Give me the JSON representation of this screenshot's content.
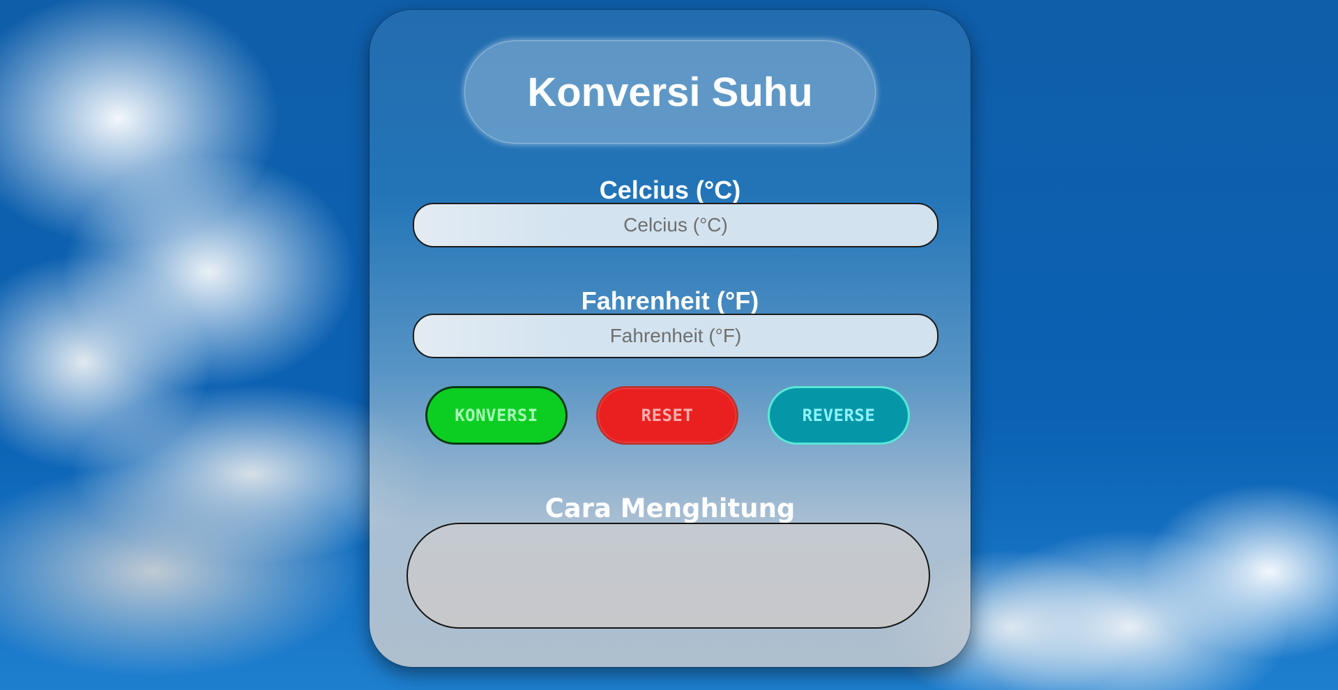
{
  "app": {
    "title": "Konversi Suhu"
  },
  "celcius": {
    "label": "Celcius (°C)",
    "placeholder": "Celcius (°C)",
    "value": ""
  },
  "fahrenheit": {
    "label": "Fahrenheit (°F)",
    "placeholder": "Fahrenheit (°F)",
    "value": ""
  },
  "buttons": {
    "konversi": "KONVERSI",
    "reset": "RESET",
    "reverse": "REVERSE"
  },
  "explanation": {
    "label": "Cara Menghitung",
    "content": ""
  },
  "colors": {
    "konversi_button": "#0cce22",
    "reset_button": "#ea2020",
    "reverse_button": "#0597a8"
  }
}
